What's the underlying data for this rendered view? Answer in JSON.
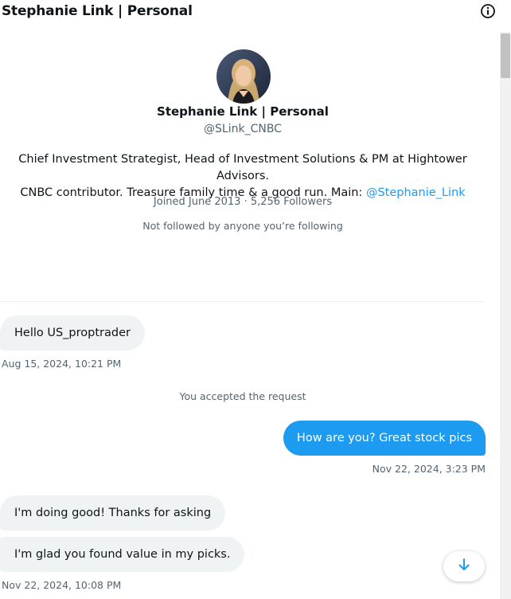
{
  "header": {
    "title": "Stephanie Link | Personal",
    "info_icon": "info-icon"
  },
  "profile": {
    "name": "Stephanie Link | Personal",
    "handle": "@SLink_CNBC",
    "bio_line1": "Chief Investment Strategist, Head of Investment Solutions & PM at Hightower Advisors.",
    "bio_line2_text": "CNBC contributor. Treasure family time & a good run. Main: ",
    "bio_link": "@Stephanie_Link",
    "joined": "Joined June 2013 · 5,256 Followers",
    "not_followed": "Not followed by anyone you’re following"
  },
  "messages": [
    {
      "direction": "in",
      "text": "Hello US_proptrader"
    },
    {
      "direction": "out",
      "text": "How are you? Great stock pics"
    },
    {
      "direction": "in",
      "text": "I'm doing good! Thanks for asking"
    },
    {
      "direction": "in",
      "text": "I'm glad you found value in my picks."
    }
  ],
  "timestamps": [
    "Aug 15, 2024, 10:21 PM",
    "Nov 22, 2024, 3:23 PM",
    "Nov 22, 2024, 10:08 PM"
  ],
  "system_message": "You accepted the request",
  "colors": {
    "accent": "#1d9bf0",
    "incoming_bubble": "#eff3f4",
    "muted_text": "#536471"
  },
  "scroll_down_icon": "arrow-down-icon"
}
